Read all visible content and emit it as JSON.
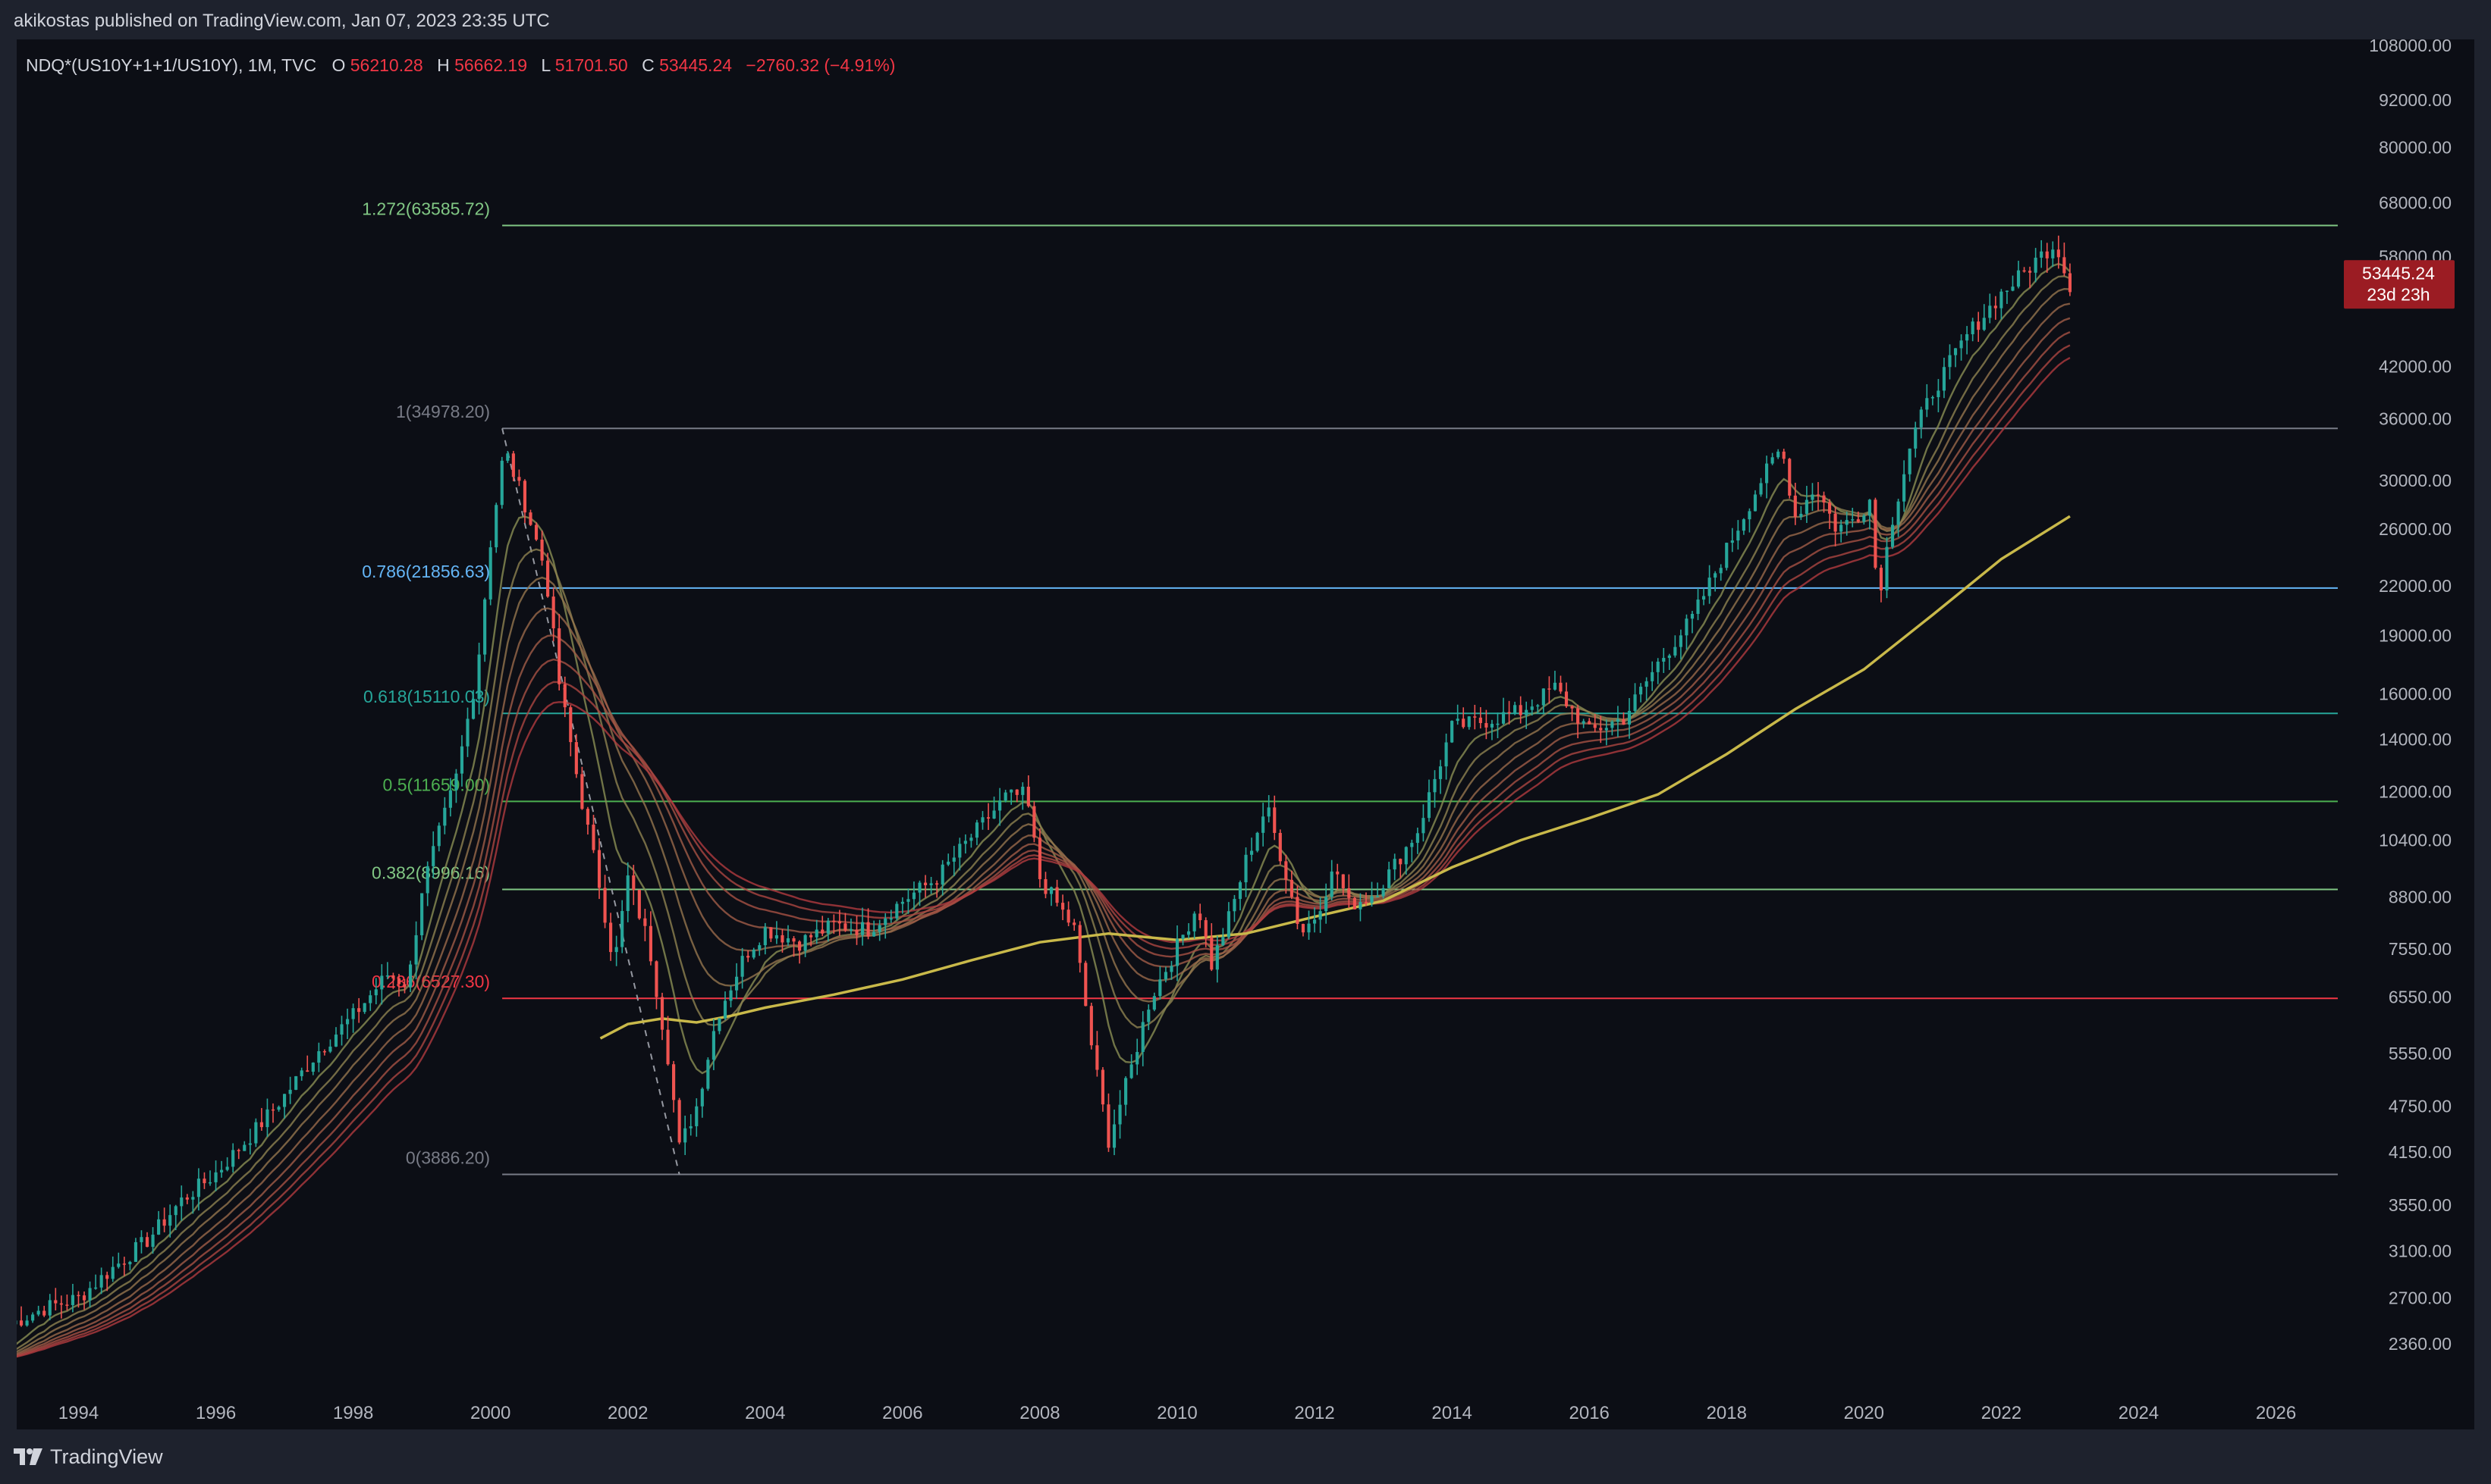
{
  "header": {
    "published_by": "akikostas published on TradingView.com, Jan 07, 2023 23:35 UTC"
  },
  "legend": {
    "symbol": "NDQ*(US10Y+1+1/US10Y), 1M, TVC",
    "open_label": "O",
    "open": "56210.28",
    "high_label": "H",
    "high": "56662.19",
    "low_label": "L",
    "low": "51701.50",
    "close_label": "C",
    "close": "53445.24",
    "change": "−2760.32 (−4.91%)"
  },
  "price_tag": {
    "price": "53445.24",
    "countdown": "23d 23h"
  },
  "footer": {
    "brand": "TradingView",
    "logo_icon": "tradingview-logo-icon"
  },
  "colors": {
    "background": "#1e222d",
    "panel": "#0c0e15",
    "up": "#26a69a",
    "down": "#ef5350",
    "text": "#d1d4dc",
    "axis_text": "#b2b5be",
    "ma200": "#c9b94a",
    "price_tag": "#9b1c23"
  },
  "chart_data": {
    "type": "candlestick",
    "y_scale": "log",
    "x_range": [
      1993.1,
      2026.9
    ],
    "y_range": [
      2050,
      110000
    ],
    "y_ticks": [
      108000,
      92000,
      80000,
      68000,
      58000,
      42000,
      36000,
      30000,
      26000,
      22000,
      19000,
      16000,
      14000,
      12000,
      10400,
      8800,
      7550,
      6550,
      5550,
      4750,
      4150,
      3550,
      3100,
      2700,
      2360
    ],
    "y_tick_labels": [
      "108000.00",
      "92000.00",
      "80000.00",
      "68000.00",
      "58000.00",
      "42000.00",
      "36000.00",
      "30000.00",
      "26000.00",
      "22000.00",
      "19000.00",
      "16000.00",
      "14000.00",
      "12000.00",
      "10400.00",
      "8800.00",
      "7550.00",
      "6550.00",
      "5550.00",
      "4750.00",
      "4150.00",
      "3550.00",
      "3100.00",
      "2700.00",
      "2360.00"
    ],
    "x_ticks": [
      1994,
      1996,
      1998,
      2000,
      2002,
      2004,
      2006,
      2008,
      2010,
      2012,
      2014,
      2016,
      2018,
      2020,
      2022,
      2024,
      2026
    ],
    "x_tick_labels": [
      "1994",
      "1996",
      "1998",
      "2000",
      "2002",
      "2004",
      "2006",
      "2008",
      "2010",
      "2012",
      "2014",
      "2016",
      "2018",
      "2020",
      "2022",
      "2024",
      "2026"
    ],
    "price_path": [
      [
        1993.0,
        2500
      ],
      [
        1993.5,
        2620
      ],
      [
        1994.0,
        2700
      ],
      [
        1994.5,
        2950
      ],
      [
        1995.0,
        3200
      ],
      [
        1995.5,
        3600
      ],
      [
        1996.0,
        3900
      ],
      [
        1996.5,
        4350
      ],
      [
        1997.0,
        4900
      ],
      [
        1997.5,
        5600
      ],
      [
        1998.0,
        6200
      ],
      [
        1998.5,
        7000
      ],
      [
        1998.8,
        6800
      ],
      [
        1999.0,
        9000
      ],
      [
        1999.5,
        12500
      ],
      [
        1999.8,
        17000
      ],
      [
        2000.0,
        25000
      ],
      [
        2000.2,
        33000
      ],
      [
        2000.5,
        28000
      ],
      [
        2000.8,
        23000
      ],
      [
        2001.0,
        16500
      ],
      [
        2001.3,
        12000
      ],
      [
        2001.6,
        9000
      ],
      [
        2001.8,
        7200
      ],
      [
        2002.0,
        9300
      ],
      [
        2002.3,
        7700
      ],
      [
        2002.6,
        5400
      ],
      [
        2002.75,
        4200
      ],
      [
        2003.0,
        4750
      ],
      [
        2003.3,
        6200
      ],
      [
        2003.7,
        7400
      ],
      [
        2004.0,
        8000
      ],
      [
        2004.5,
        7700
      ],
      [
        2005.0,
        8100
      ],
      [
        2005.5,
        8000
      ],
      [
        2006.0,
        8700
      ],
      [
        2006.5,
        9300
      ],
      [
        2007.0,
        10500
      ],
      [
        2007.5,
        11800
      ],
      [
        2007.8,
        11900
      ],
      [
        2008.0,
        9300
      ],
      [
        2008.5,
        8000
      ],
      [
        2008.75,
        5700
      ],
      [
        2009.0,
        4300
      ],
      [
        2009.3,
        5200
      ],
      [
        2009.6,
        6500
      ],
      [
        2010.0,
        7600
      ],
      [
        2010.3,
        8600
      ],
      [
        2010.5,
        7200
      ],
      [
        2010.8,
        8500
      ],
      [
        2011.0,
        9800
      ],
      [
        2011.3,
        11500
      ],
      [
        2011.6,
        9300
      ],
      [
        2011.8,
        7900
      ],
      [
        2012.0,
        8300
      ],
      [
        2012.3,
        9600
      ],
      [
        2012.5,
        8600
      ],
      [
        2012.8,
        8800
      ],
      [
        2013.0,
        9200
      ],
      [
        2013.5,
        10700
      ],
      [
        2014.0,
        14500
      ],
      [
        2014.5,
        14800
      ],
      [
        2015.0,
        15200
      ],
      [
        2015.5,
        16300
      ],
      [
        2016.0,
        14300
      ],
      [
        2016.5,
        14900
      ],
      [
        2017.0,
        17500
      ],
      [
        2017.5,
        20000
      ],
      [
        2018.0,
        24500
      ],
      [
        2018.5,
        30000
      ],
      [
        2018.8,
        33000
      ],
      [
        2019.0,
        27000
      ],
      [
        2019.3,
        29500
      ],
      [
        2019.6,
        26000
      ],
      [
        2019.9,
        27000
      ],
      [
        2020.1,
        28500
      ],
      [
        2020.2,
        21000
      ],
      [
        2020.4,
        26500
      ],
      [
        2020.7,
        34000
      ],
      [
        2021.0,
        39000
      ],
      [
        2021.5,
        46000
      ],
      [
        2022.0,
        52000
      ],
      [
        2022.3,
        55000
      ],
      [
        2022.6,
        58500
      ],
      [
        2022.8,
        60500
      ],
      [
        2022.9,
        56200
      ],
      [
        2023.0,
        53445.24
      ]
    ],
    "fib_levels": [
      {
        "label": "1.272(63585.72)",
        "ratio": "1.272",
        "value": 63585.72,
        "color": "#81c784"
      },
      {
        "label": "1(34978.20)",
        "ratio": "1",
        "value": 34978.2,
        "color": "#787b86"
      },
      {
        "label": "0.786(21856.63)",
        "ratio": "0.786",
        "value": 21856.63,
        "color": "#64b5f6"
      },
      {
        "label": "0.618(15110.03)",
        "ratio": "0.618",
        "value": 15110.03,
        "color": "#26a69a"
      },
      {
        "label": "0.5(11659.00)",
        "ratio": "0.5",
        "value": 11659.0,
        "color": "#4caf50"
      },
      {
        "label": "0.382(8996.16)",
        "ratio": "0.382",
        "value": 8996.16,
        "color": "#81c784"
      },
      {
        "label": "0.236(6527.30)",
        "ratio": "0.236",
        "value": 6527.3,
        "color": "#f23645"
      },
      {
        "label": "0(3886.20)",
        "ratio": "0",
        "value": 3886.2,
        "color": "#787b86"
      }
    ],
    "fib_x_start": 2000.17,
    "fib_anchor_line": [
      [
        2000.17,
        34978.2
      ],
      [
        2002.75,
        3886.2
      ]
    ],
    "ma200_path": [
      [
        2001.6,
        5800
      ],
      [
        2002.0,
        6050
      ],
      [
        2002.5,
        6150
      ],
      [
        2003.0,
        6080
      ],
      [
        2003.5,
        6200
      ],
      [
        2004.0,
        6350
      ],
      [
        2005.0,
        6600
      ],
      [
        2006.0,
        6900
      ],
      [
        2007.0,
        7300
      ],
      [
        2008.0,
        7700
      ],
      [
        2009.0,
        7900
      ],
      [
        2010.0,
        7750
      ],
      [
        2011.0,
        7900
      ],
      [
        2012.0,
        8300
      ],
      [
        2013.0,
        8700
      ],
      [
        2014.0,
        9600
      ],
      [
        2015.0,
        10400
      ],
      [
        2016.0,
        11100
      ],
      [
        2017.0,
        11900
      ],
      [
        2018.0,
        13400
      ],
      [
        2019.0,
        15300
      ],
      [
        2020.0,
        17200
      ],
      [
        2021.0,
        20200
      ],
      [
        2022.0,
        23800
      ],
      [
        2023.0,
        27000
      ]
    ],
    "current_price": 53445.24
  }
}
